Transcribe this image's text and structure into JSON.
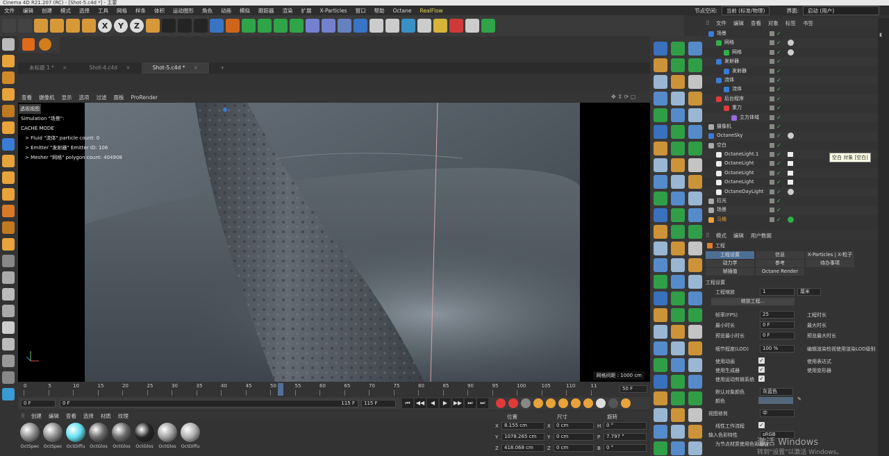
{
  "window": {
    "title": "Cinema 4D R21.207 (RC) - [Shot-5.c4d *] - 主要"
  },
  "menu": {
    "items": [
      "文件",
      "编辑",
      "创建",
      "模式",
      "选择",
      "工具",
      "网格",
      "样条",
      "体积",
      "运动图形",
      "角色",
      "动画",
      "模拟",
      "跟踪器",
      "渲染",
      "扩展",
      "X-Particles",
      "窗口",
      "帮助",
      "Octane"
    ],
    "realflow": "RealFlow",
    "node_space_label": "节点空间:",
    "node_space_value": "当前 (标准/物理)",
    "interface_label": "界面:",
    "interface_value": "启动 (用户)"
  },
  "tabs": [
    {
      "label": "未标题 1 *",
      "active": false
    },
    {
      "label": "Shot-4.c4d",
      "active": false
    },
    {
      "label": "Shot-5.c4d *",
      "active": true
    }
  ],
  "viewport": {
    "menu": [
      "查看",
      "摄像机",
      "显示",
      "选项",
      "过滤",
      "面板",
      "ProRender"
    ],
    "label": "透视视图",
    "info": [
      "Simulation \"场景\":",
      "CACHE MODE",
      "> Fluid \"流体\" particle count: 0",
      "> Emitter \"发射器\" Emitter ID: 106",
      "> Mesher \"网格\" polygon count: 404908"
    ],
    "grid_spacing": "网格间距 : 1000 cm"
  },
  "timeline": {
    "ticks": [
      "0",
      "5",
      "10",
      "15",
      "20",
      "25",
      "30",
      "35",
      "40",
      "45",
      "50",
      "55",
      "60",
      "65",
      "70",
      "75",
      "80",
      "85",
      "90",
      "95",
      "100",
      "105",
      "110",
      "11"
    ],
    "current_frame": "50 F",
    "playhead_fraction": 0.43
  },
  "transport": {
    "start": "0 F",
    "start2": "0 F",
    "end": "115 F",
    "end2": "115 F"
  },
  "material_panel": {
    "menu": [
      "创建",
      "编辑",
      "查看",
      "选择",
      "材质",
      "纹理"
    ],
    "materials": [
      {
        "name": "OctSpec",
        "color": "#8c8c8c"
      },
      {
        "name": "OctSpec",
        "color": "#8c8c8c"
      },
      {
        "name": "OctDiffu",
        "color": "#5fe0f0"
      },
      {
        "name": "OctGlos",
        "color": "#6a6a6a"
      },
      {
        "name": "OctGlos",
        "color": "#6a6a6a"
      },
      {
        "name": "OctGlos",
        "color": "#262626"
      },
      {
        "name": "OctGlos",
        "color": "#a0a0a0"
      },
      {
        "name": "OctDiffu",
        "color": "#b0b0b0"
      }
    ]
  },
  "coords": {
    "headers": [
      "位置",
      "尺寸",
      "旋转"
    ],
    "rows": [
      {
        "axis": "X",
        "pos": "8.155 cm",
        "saxis": "X",
        "size": "0 cm",
        "raxis": "H",
        "rot": "0 °"
      },
      {
        "axis": "Y",
        "pos": "1078.265 cm",
        "saxis": "Y",
        "size": "0 cm",
        "raxis": "P",
        "rot": "7.797 °"
      },
      {
        "axis": "Z",
        "pos": "418.068 cm",
        "saxis": "Z",
        "size": "0 cm",
        "raxis": "B",
        "rot": "0 °"
      }
    ]
  },
  "object_manager": {
    "menu": [
      "文件",
      "编辑",
      "查看",
      "对象",
      "标签",
      "书签"
    ],
    "objects": [
      {
        "name": "场景",
        "indent": 0,
        "color": "#dcdcdc"
      },
      {
        "name": "网格",
        "indent": 1,
        "color": "#dcdcdc"
      },
      {
        "name": "网格",
        "indent": 2,
        "color": "#dcdcdc"
      },
      {
        "name": "发射器",
        "indent": 1,
        "color": "#dcdcdc"
      },
      {
        "name": "发射器",
        "indent": 2,
        "color": "#dcdcdc"
      },
      {
        "name": "流体",
        "indent": 1,
        "color": "#dcdcdc"
      },
      {
        "name": "流体",
        "indent": 2,
        "color": "#dcdcdc"
      },
      {
        "name": "后台程序",
        "indent": 1,
        "color": "#dcdcdc"
      },
      {
        "name": "重力",
        "indent": 2,
        "color": "#dcdcdc"
      },
      {
        "name": "立方体域",
        "indent": 3,
        "color": "#dcdcdc"
      },
      {
        "name": "摄像机",
        "indent": 0,
        "color": "#dcdcdc"
      },
      {
        "name": "OctaneSky",
        "indent": 0,
        "color": "#dcdcdc"
      },
      {
        "name": "空白",
        "indent": 0,
        "color": "#dcdcdc"
      },
      {
        "name": "OctaneLight.1",
        "indent": 1,
        "color": "#dcdcdc"
      },
      {
        "name": "OctaneLight",
        "indent": 1,
        "color": "#dcdcdc"
      },
      {
        "name": "OctaneLight",
        "indent": 1,
        "color": "#dcdcdc"
      },
      {
        "name": "OctaneLight",
        "indent": 1,
        "color": "#dcdcdc"
      },
      {
        "name": "OctaneDayLight",
        "indent": 1,
        "color": "#dcdcdc"
      },
      {
        "name": "拉光",
        "indent": 0,
        "color": "#dcdcdc"
      },
      {
        "name": "场景",
        "indent": 0,
        "color": "#dcdcdc"
      },
      {
        "name": "马桶",
        "indent": 0,
        "color": "#e89a3c"
      }
    ],
    "tooltip": "空白 对象 [空白]"
  },
  "attributes": {
    "menu": [
      "模式",
      "编辑",
      "用户数据"
    ],
    "object_label": "工程",
    "tabs": [
      "工程设置",
      "信息",
      "X-Particles | X-粒子",
      "动力学",
      "参考",
      "待办事项",
      "帧插值",
      "Octane Render"
    ],
    "section": "工程设置",
    "scale_label": "工程缩放",
    "scale_value": "1",
    "scale_unit": "厘米",
    "scale_button": "缩放工程...",
    "fps_label": "帧率(FPS)",
    "fps_value": "25",
    "duration_label": "工程时长",
    "min_time_label": "最小时长",
    "min_time_value": "0 F",
    "max_time_label": "最大时长",
    "preview_min_label": "预览最小时长",
    "preview_min_value": "0 F",
    "preview_max_label": "预览最大时长",
    "lod_label": "细节程度(LOD)",
    "lod_value": "100 %",
    "lod_right": "编辑渲染检视使用渲染LOD级别",
    "use_anim": "使用动画",
    "use_expr": "使用表达式",
    "use_gen": "使用生成器",
    "use_deform": "使用变形器",
    "use_mograph": "使用运动剪辑系统",
    "default_color_label": "默认对象颜色",
    "default_color_value": "灰蓝色",
    "color_label": "颜色",
    "view_clip_label": "视图修剪",
    "view_clip_value": "中",
    "linear_label": "线性工作流程",
    "input_color_label": "输入色彩特性",
    "input_color_value": "sRGB",
    "node_label": "为节点材质使用色彩通道"
  },
  "watermark": {
    "line1": "激活 Windows",
    "line2": "转到\"设置\"以激活 Windows。"
  }
}
